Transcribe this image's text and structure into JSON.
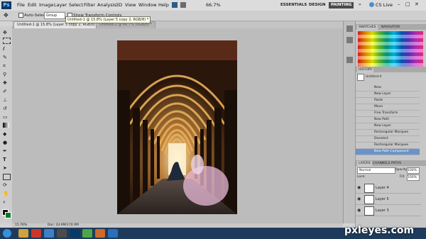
{
  "menubar": {
    "logo": "Ps",
    "items": [
      "File",
      "Edit",
      "Image",
      "Layer",
      "Select",
      "Filter",
      "Analysis",
      "3D",
      "View",
      "Window",
      "Help"
    ],
    "zoom": "66.7%",
    "workspaces": [
      "ESSENTIALS",
      "DESIGN",
      "PAINTING"
    ],
    "cs_live": "CS Live"
  },
  "options": {
    "auto_select": "Auto-Select:",
    "group": "Group",
    "transform": "Show Transform Controls"
  },
  "tabs": {
    "tab1": "Untitled-1 @ 15.8% (Layer 5 copy 2, RGB/8) *",
    "tab2": "Untitled-2 @ 66.7% (RGB/8) *"
  },
  "tooltip": "Untitled-1 @ 15.8% (Layer 5 copy 2, RGB/8) *",
  "status": {
    "zoom": "15.76%",
    "doc": "Doc: 24.9M/170.0M"
  },
  "panels": {
    "swatches_tab": "SWATCHES",
    "navigator_tab": "NAVIGATOR",
    "history_tab": "HISTORY",
    "history_snapshot": "Untitled-4",
    "history_items": [
      "New",
      "New Layer",
      "Paste",
      "Move",
      "Free Transform",
      "New Path",
      "New Layer",
      "Rectangular Marquee",
      "Deselect",
      "Rectangular Marquee",
      "New Path Component"
    ],
    "layers_tab": "LAYERS",
    "channels_tab": "CHANNELS",
    "paths_tab": "PATHS",
    "blend": "Normal",
    "opacity_label": "Opacity:",
    "opacity": "100%",
    "lock_label": "Lock:",
    "fill_label": "Fill:",
    "fill": "100%",
    "layers": [
      "Layer 4",
      "Layer 5",
      "Layer 3"
    ]
  },
  "watermark": "pxleyes.com",
  "colors": {
    "foreground": "#111111",
    "background": "#0a7a2a",
    "accent": "#2a6fb8"
  }
}
